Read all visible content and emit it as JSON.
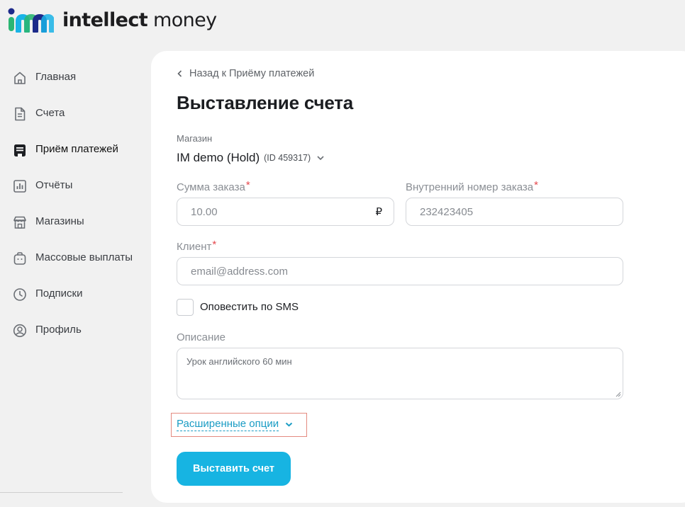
{
  "brand": {
    "name_bold": "intellect",
    "name_rest": " money"
  },
  "colors": {
    "accent": "#17b4e2",
    "link": "#1a9cc4",
    "required": "#e5484d",
    "highlight": "#e48a80"
  },
  "sidebar": {
    "items": [
      {
        "label": "Главная",
        "icon": "home-icon"
      },
      {
        "label": "Счета",
        "icon": "document-icon"
      },
      {
        "label": "Приём платежей",
        "icon": "payment-terminal-icon",
        "active": true
      },
      {
        "label": "Отчёты",
        "icon": "report-chart-icon"
      },
      {
        "label": "Магазины",
        "icon": "store-icon"
      },
      {
        "label": "Массовые выплаты",
        "icon": "payouts-bag-icon"
      },
      {
        "label": "Подписки",
        "icon": "clock-icon"
      },
      {
        "label": "Профиль",
        "icon": "user-icon"
      }
    ]
  },
  "main": {
    "back_label": "Назад к Приёму платежей",
    "title": "Выставление счета",
    "shop": {
      "label": "Магазин",
      "name": "IM demo (Hold)",
      "id": "(ID 459317)"
    },
    "amount": {
      "label": "Сумма заказа",
      "required_mark": "*",
      "value": "10.00",
      "currency": "₽"
    },
    "order_number": {
      "label": "Внутренний номер заказа",
      "required_mark": "*",
      "value": "232423405"
    },
    "client": {
      "label": "Клиент",
      "required_mark": "*",
      "placeholder": "email@address.com"
    },
    "sms": {
      "label": "Оповестить по SMS",
      "checked": false
    },
    "description": {
      "label": "Описание",
      "value": "Урок английского 60 мин"
    },
    "advanced_label": "Расширенные опции",
    "submit_label": "Выставить счет"
  }
}
